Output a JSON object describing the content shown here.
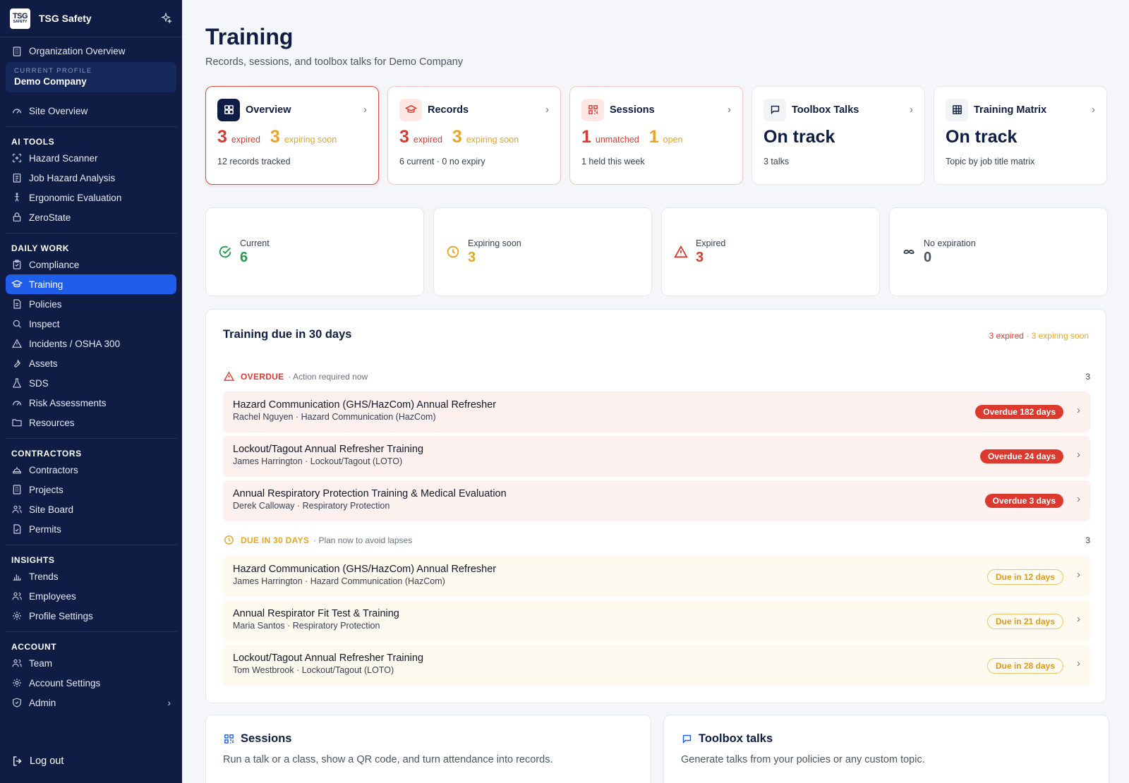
{
  "app": {
    "name": "TSG Safety",
    "logo_line1": "TSG",
    "logo_line2": "SAFETY"
  },
  "sidebar": {
    "org_overview": "Organization Overview",
    "profile_caption": "CURRENT PROFILE",
    "profile_name": "Demo Company",
    "site_overview": "Site Overview",
    "sections": [
      {
        "title": "AI TOOLS",
        "items": [
          "Hazard Scanner",
          "Job Hazard Analysis",
          "Ergonomic Evaluation",
          "ZeroState"
        ]
      },
      {
        "title": "DAILY WORK",
        "items": [
          "Compliance",
          "Training",
          "Policies",
          "Inspect",
          "Incidents / OSHA 300",
          "Assets",
          "SDS",
          "Risk Assessments",
          "Resources"
        ]
      },
      {
        "title": "CONTRACTORS",
        "items": [
          "Contractors",
          "Projects",
          "Site Board",
          "Permits"
        ]
      },
      {
        "title": "INSIGHTS",
        "items": [
          "Trends",
          "Employees",
          "Profile Settings"
        ]
      },
      {
        "title": "ACCOUNT",
        "items": [
          "Team",
          "Account Settings",
          "Admin"
        ]
      }
    ],
    "active_item": "Training",
    "logout": "Log out"
  },
  "page": {
    "title": "Training",
    "subtitle": "Records, sessions, and toolbox talks for Demo Company"
  },
  "tabs": [
    {
      "name": "Overview",
      "icon": "grid-icon",
      "n1": "3",
      "l1": "expired",
      "n2": "3",
      "l2": "expiring soon",
      "foot": "12 records tracked"
    },
    {
      "name": "Records",
      "icon": "graduation-cap-icon",
      "n1": "3",
      "l1": "expired",
      "n2": "3",
      "l2": "expiring soon",
      "foot": "6 current · 0 no expiry"
    },
    {
      "name": "Sessions",
      "icon": "qr-code-icon",
      "n1": "1",
      "l1": "unmatched",
      "n2": "1",
      "l2": "open",
      "foot": "1 held this week"
    },
    {
      "name": "Toolbox Talks",
      "icon": "message-icon",
      "status": "On track",
      "foot": "3 talks"
    },
    {
      "name": "Training Matrix",
      "icon": "table-icon",
      "status": "On track",
      "foot": "Topic by job title matrix"
    }
  ],
  "stats": [
    {
      "label": "Current",
      "value": "6",
      "icon": "check-circle-icon",
      "color": "#1f9d4f"
    },
    {
      "label": "Expiring soon",
      "value": "3",
      "icon": "clock-icon",
      "color": "#e9a423"
    },
    {
      "label": "Expired",
      "value": "3",
      "icon": "alert-triangle-icon",
      "color": "#dc3a2e"
    },
    {
      "label": "No expiration",
      "value": "0",
      "icon": "infinity-icon",
      "color": "#4b5563"
    }
  ],
  "due": {
    "title": "Training due in 30 days",
    "summary_expired": "3 expired",
    "summary_sep": " · ",
    "summary_soon": "3 expiring soon",
    "overdue": {
      "name": "OVERDUE",
      "note": "· Action required now",
      "count": "3",
      "rows": [
        {
          "title": "Hazard Communication (GHS/HazCom) Annual Refresher",
          "sub": "Rachel Nguyen · Hazard Communication (HazCom)",
          "badge": "Overdue 182 days"
        },
        {
          "title": "Lockout/Tagout Annual Refresher Training",
          "sub": "James Harrington · Lockout/Tagout (LOTO)",
          "badge": "Overdue 24 days"
        },
        {
          "title": "Annual Respiratory Protection Training & Medical Evaluation",
          "sub": "Derek Calloway · Respiratory Protection",
          "badge": "Overdue 3 days"
        }
      ]
    },
    "soon": {
      "name": "DUE IN 30 DAYS",
      "note": "· Plan now to avoid lapses",
      "count": "3",
      "rows": [
        {
          "title": "Hazard Communication (GHS/HazCom) Annual Refresher",
          "sub": "James Harrington · Hazard Communication (HazCom)",
          "badge": "Due in 12 days"
        },
        {
          "title": "Annual Respirator Fit Test & Training",
          "sub": "Maria Santos · Respiratory Protection",
          "badge": "Due in 21 days"
        },
        {
          "title": "Lockout/Tagout Annual Refresher Training",
          "sub": "Tom Westbrook · Lockout/Tagout (LOTO)",
          "badge": "Due in 28 days"
        }
      ]
    }
  },
  "bottom": {
    "sessions_title": "Sessions",
    "sessions_desc": "Run a talk or a class, show a QR code, and turn attendance into records.",
    "talks_title": "Toolbox talks",
    "talks_desc": "Generate talks from your policies or any custom topic."
  },
  "colors": {
    "navy": "#0f1d45",
    "accent": "#1e5eea",
    "red": "#dc3a2e",
    "amber": "#e9a423",
    "green": "#1f9d4f"
  }
}
